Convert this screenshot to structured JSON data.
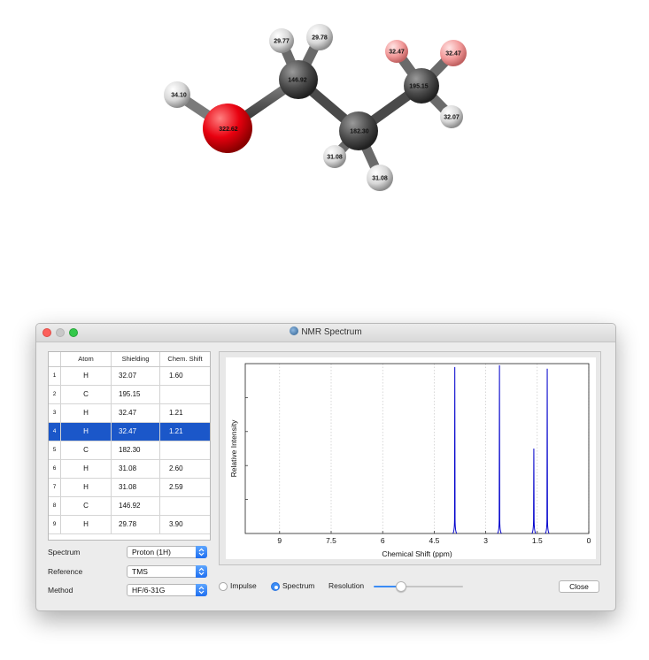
{
  "molecule": {
    "atoms": [
      {
        "element": "O",
        "shielding": "322.62",
        "color": "#e8000f"
      },
      {
        "element": "H",
        "shielding": "34.10",
        "color": "#e8e8e8"
      },
      {
        "element": "C",
        "shielding": "146.92",
        "color": "#555555"
      },
      {
        "element": "H",
        "shielding": "29.77",
        "color": "#e8e8e8"
      },
      {
        "element": "H",
        "shielding": "29.78",
        "color": "#e8e8e8"
      },
      {
        "element": "C",
        "shielding": "182.30",
        "color": "#555555"
      },
      {
        "element": "H",
        "shielding": "31.08",
        "color": "#e8e8e8"
      },
      {
        "element": "H",
        "shielding": "31.08",
        "color": "#e8e8e8"
      },
      {
        "element": "C",
        "shielding": "195.15",
        "color": "#555555"
      },
      {
        "element": "H",
        "shielding": "32.47",
        "color": "#f2a0a0"
      },
      {
        "element": "H",
        "shielding": "32.47",
        "color": "#f2a0a0"
      },
      {
        "element": "H",
        "shielding": "32.07",
        "color": "#e8e8e8"
      }
    ]
  },
  "window": {
    "title": "NMR Spectrum",
    "icon": "nmr-app-icon"
  },
  "table": {
    "headers": [
      "",
      "Atom",
      "Shielding",
      "Chem. Shift"
    ],
    "rows": [
      {
        "index": "1",
        "atom": "H",
        "shielding": "32.07",
        "shift": "1.60",
        "selected": false
      },
      {
        "index": "2",
        "atom": "C",
        "shielding": "195.15",
        "shift": "",
        "selected": false
      },
      {
        "index": "3",
        "atom": "H",
        "shielding": "32.47",
        "shift": "1.21",
        "selected": false
      },
      {
        "index": "4",
        "atom": "H",
        "shielding": "32.47",
        "shift": "1.21",
        "selected": true
      },
      {
        "index": "5",
        "atom": "C",
        "shielding": "182.30",
        "shift": "",
        "selected": false
      },
      {
        "index": "6",
        "atom": "H",
        "shielding": "31.08",
        "shift": "2.60",
        "selected": false
      },
      {
        "index": "7",
        "atom": "H",
        "shielding": "31.08",
        "shift": "2.59",
        "selected": false
      },
      {
        "index": "8",
        "atom": "C",
        "shielding": "146.92",
        "shift": "",
        "selected": false
      },
      {
        "index": "9",
        "atom": "H",
        "shielding": "29.78",
        "shift": "3.90",
        "selected": false
      }
    ]
  },
  "form": {
    "spectrum_label": "Spectrum",
    "spectrum_value": "Proton (1H)",
    "reference_label": "Reference",
    "reference_value": "TMS",
    "method_label": "Method",
    "method_value": "HF/6-31G"
  },
  "controls": {
    "impulse_label": "Impulse",
    "spectrum_label": "Spectrum",
    "selected_mode": "Spectrum",
    "resolution_label": "Resolution",
    "resolution_level": 0.33,
    "close_label": "Close"
  },
  "colors": {
    "selection": "#1b57c9",
    "accent": "#3b8cf5",
    "spectrum_line": "#0000cc"
  },
  "chart_data": {
    "type": "line",
    "xlabel": "Chemical Shift (ppm)",
    "ylabel": "Relative Intensity",
    "xlim": [
      10,
      0
    ],
    "x_reversed": true,
    "ylim": [
      0,
      1
    ],
    "grid": true,
    "xticks": [
      "9",
      "7.5",
      "6",
      "4.5",
      "3",
      "1.5",
      "0"
    ],
    "xtick_values": [
      9,
      7.5,
      6,
      4.5,
      3,
      1.5,
      0
    ],
    "peaks": [
      {
        "shift": 3.9,
        "intensity": 0.98
      },
      {
        "shift": 2.6,
        "intensity": 0.99
      },
      {
        "shift": 1.6,
        "intensity": 0.5
      },
      {
        "shift": 1.21,
        "intensity": 0.97
      }
    ]
  }
}
